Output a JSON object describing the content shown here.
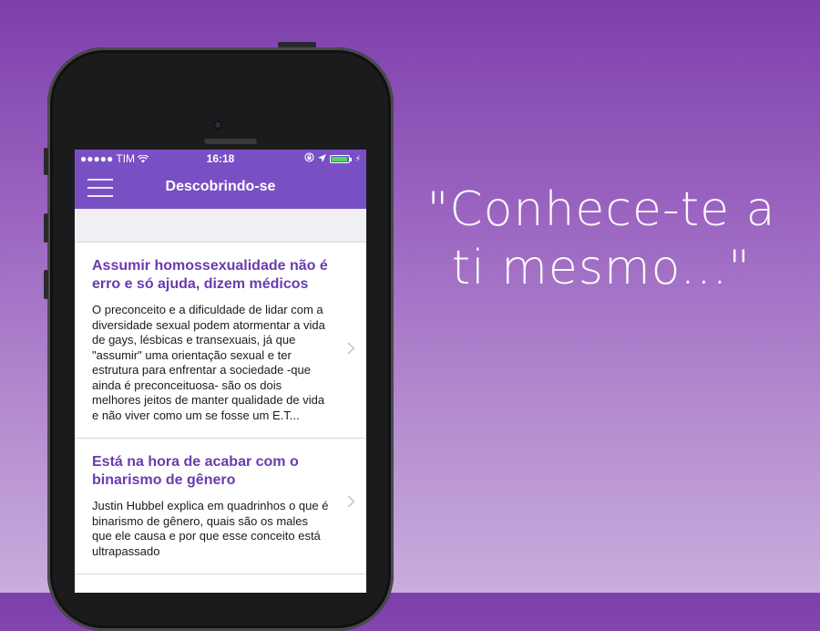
{
  "statusbar": {
    "carrier": "●●●●● TIM",
    "time": "16:18",
    "icons": [
      "wifi-icon",
      "lock-rotation-icon",
      "location-arrow-icon",
      "battery-icon"
    ]
  },
  "navbar": {
    "title": "Descobrindo-se",
    "menu_icon": "hamburger-menu-icon"
  },
  "articles": [
    {
      "title": "Assumir homossexualidade não é erro e só ajuda, dizem médicos",
      "summary": "O preconceito e a dificuldade de lidar com a diversidade sexual podem atormentar a vida de gays, lésbicas e transexuais, já que \"assumir\" uma orientação sexual e ter estrutura para enfrentar a sociedade -que ainda é preconceituosa- são os dois melhores jeitos de manter qualidade de vida e não viver como um se fosse um E.T..."
    },
    {
      "title": "Está na hora de acabar com o binarismo de gênero",
      "summary": "Justin Hubbel explica em quadrinhos o que é binarismo de gênero, quais são os males que ele causa e por que esse conceito está ultrapassado"
    }
  ],
  "tagline": {
    "line1": "\"Conhece-te a",
    "line2": "ti mesmo...\""
  },
  "colors": {
    "accent": "#7850c4",
    "title": "#6a3bb0",
    "background_top": "#7d3fab",
    "background_bottom": "#c9addc"
  }
}
